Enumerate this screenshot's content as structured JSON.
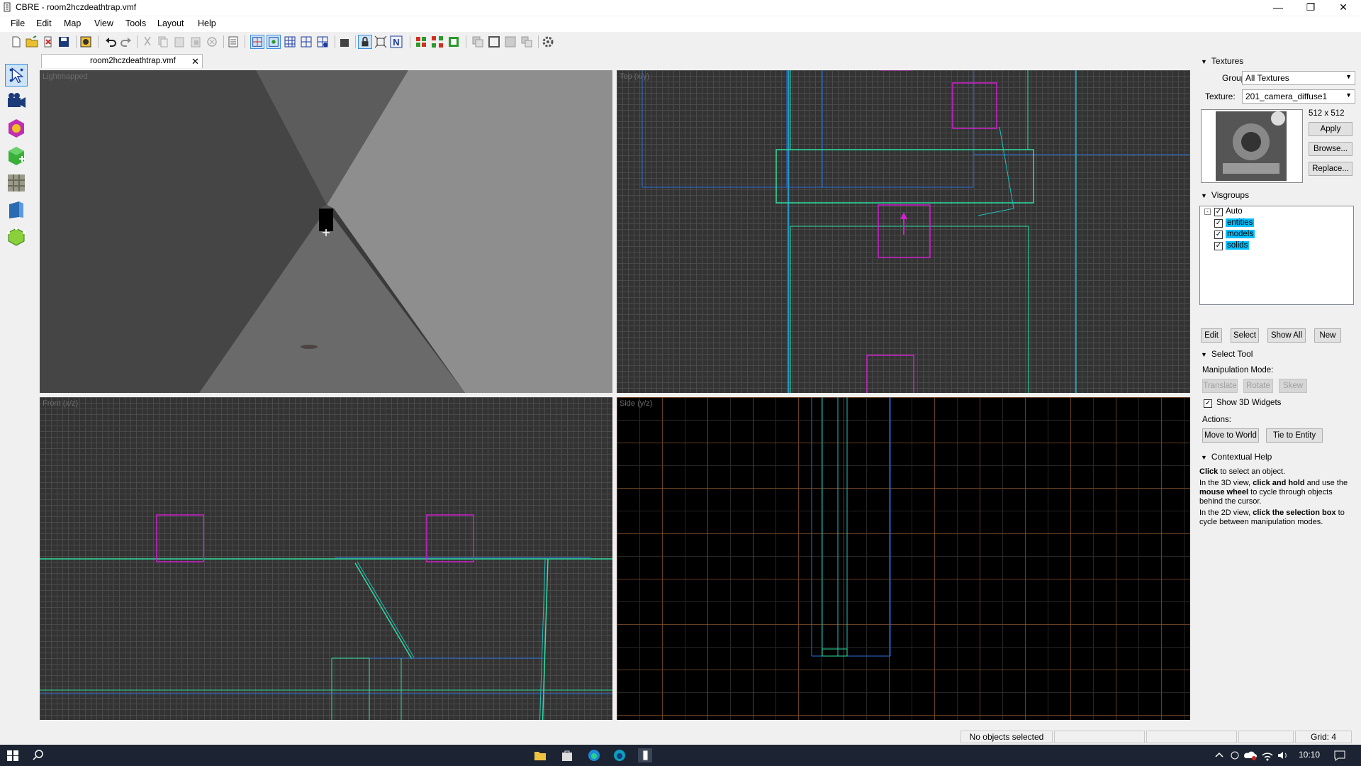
{
  "window": {
    "title": "CBRE - room2hczdeathtrap.vmf"
  },
  "menu": [
    "File",
    "Edit",
    "Map",
    "View",
    "Tools",
    "Layout",
    "Help"
  ],
  "tab": {
    "label": "room2hczdeathtrap.vmf"
  },
  "viewports": {
    "topleft": "Lightmapped",
    "topright": "Top (x/y)",
    "bottomleft": "Front (x/z)",
    "bottomright": "Side (y/z)"
  },
  "textures": {
    "header": "Textures",
    "group_label": "Group:",
    "group_value": "All Textures",
    "texture_label": "Texture:",
    "texture_value": "201_camera_diffuse1",
    "size": "512 x 512",
    "apply": "Apply",
    "browse": "Browse...",
    "replace": "Replace..."
  },
  "visgroups": {
    "header": "Visgroups",
    "items": [
      {
        "name": "Auto"
      },
      {
        "name": "entities"
      },
      {
        "name": "models"
      },
      {
        "name": "solids"
      }
    ],
    "edit": "Edit",
    "select": "Select",
    "show_all": "Show All",
    "new": "New"
  },
  "select_tool": {
    "header": "Select Tool",
    "manipulation_label": "Manipulation Mode:",
    "translate": "Translate",
    "rotate": "Rotate",
    "skew": "Skew",
    "show_widgets": "Show 3D Widgets",
    "actions_label": "Actions:",
    "move_to_world": "Move to World",
    "tie_to_entity": "Tie to Entity"
  },
  "help": {
    "header": "Contextual Help",
    "p1_bold": "Click",
    "p1_rest": " to select an object.",
    "p2_a": "In the 3D view, ",
    "p2_b": "click and hold",
    "p2_c": " and use the ",
    "p2_d": "mouse wheel",
    "p2_e": " to cycle through objects behind the cursor.",
    "p3_a": "In the 2D view, ",
    "p3_b": "click the selection box",
    "p3_c": " to cycle between manipulation modes."
  },
  "status": {
    "selection": "No objects selected",
    "grid": "Grid: 4"
  },
  "taskbar": {
    "time": "10:10"
  },
  "colors": {
    "brush": "#2de0a0",
    "entity": "#d020d0",
    "blue": "#2a70d8",
    "cyan": "#20d0d0"
  }
}
